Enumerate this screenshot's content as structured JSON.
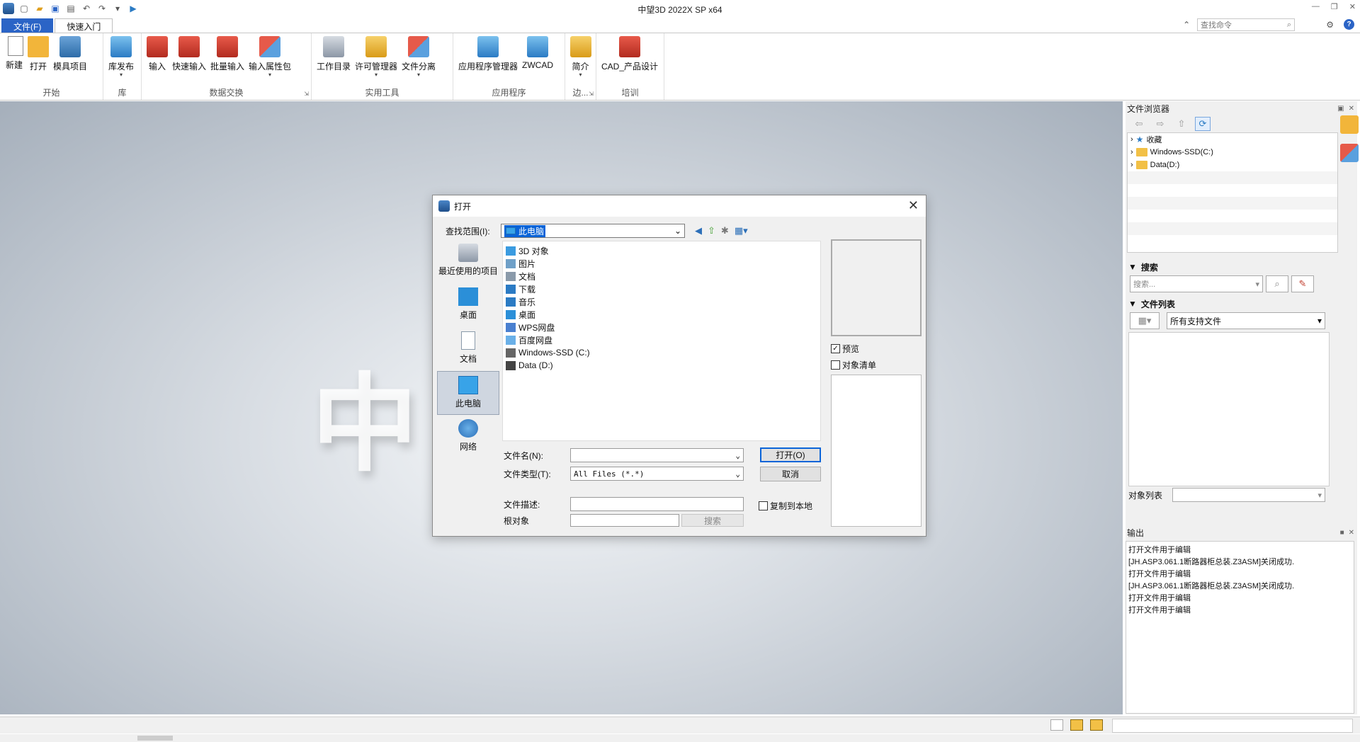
{
  "window": {
    "title": "中望3D 2022X SP x64",
    "search_cmd_placeholder": "查找命令"
  },
  "ribbon_tabs": [
    {
      "label": "文件(F)"
    },
    {
      "label": "快速入门"
    }
  ],
  "ribbon_groups": [
    {
      "label": "开始",
      "buttons": [
        {
          "label": "新建",
          "icon": "new-doc-icon"
        },
        {
          "label": "打开",
          "icon": "open-folder-icon"
        },
        {
          "label": "模具项目",
          "icon": "mold-project-icon"
        }
      ]
    },
    {
      "label": "库",
      "buttons": [
        {
          "label": "库发布",
          "icon": "library-publish-icon"
        }
      ]
    },
    {
      "label": "数据交换",
      "buttons": [
        {
          "label": "输入",
          "icon": "import-icon"
        },
        {
          "label": "快速输入",
          "icon": "quick-import-icon"
        },
        {
          "label": "批量输入",
          "icon": "batch-import-icon"
        },
        {
          "label": "输入属性包",
          "icon": "import-attr-pack-icon"
        }
      ]
    },
    {
      "label": "实用工具",
      "buttons": [
        {
          "label": "工作目录",
          "icon": "work-dir-icon"
        },
        {
          "label": "许可管理器",
          "icon": "license-manager-icon"
        },
        {
          "label": "文件分离",
          "icon": "file-split-icon"
        }
      ]
    },
    {
      "label": "应用程序",
      "buttons": [
        {
          "label": "应用程序管理器",
          "icon": "app-manager-icon"
        },
        {
          "label": "ZWCAD",
          "icon": "zwcad-icon"
        }
      ]
    },
    {
      "label": "边...",
      "buttons": [
        {
          "label": "简介",
          "icon": "intro-icon"
        }
      ]
    },
    {
      "label": "培训",
      "buttons": [
        {
          "label": "CAD_产品设计",
          "icon": "cad-product-design-icon"
        }
      ]
    }
  ],
  "dialog": {
    "title": "打开",
    "look_in_label": "查找范围(I):",
    "look_in_value": "此电脑",
    "places": [
      {
        "label": "最近使用的项目",
        "icon": "recent-items-icon"
      },
      {
        "label": "桌面",
        "icon": "desktop-icon"
      },
      {
        "label": "文档",
        "icon": "documents-icon"
      },
      {
        "label": "此电脑",
        "icon": "this-pc-icon"
      },
      {
        "label": "网络",
        "icon": "network-icon"
      }
    ],
    "files": [
      {
        "name": "3D 对象",
        "icon": "3d-objects-icon",
        "color": "#3a9be0"
      },
      {
        "name": "图片",
        "icon": "pictures-icon",
        "color": "#6fa0c8"
      },
      {
        "name": "文档",
        "icon": "documents-icon",
        "color": "#8a9aaa"
      },
      {
        "name": "下载",
        "icon": "downloads-icon",
        "color": "#2b7bc4"
      },
      {
        "name": "音乐",
        "icon": "music-icon",
        "color": "#2b7bc4"
      },
      {
        "name": "桌面",
        "icon": "desktop-icon",
        "color": "#2b8fd8"
      },
      {
        "name": "WPS网盘",
        "icon": "wps-cloud-icon",
        "color": "#4a80d0"
      },
      {
        "name": "百度网盘",
        "icon": "baidu-cloud-icon",
        "color": "#6ab0e8"
      },
      {
        "name": "Windows-SSD (C:)",
        "icon": "drive-c-icon",
        "color": "#666666"
      },
      {
        "name": "Data (D:)",
        "icon": "drive-d-icon",
        "color": "#444444"
      }
    ],
    "preview_label": "预览",
    "object_list_label": "对象清单",
    "filename_label": "文件名(N):",
    "filename_value": "",
    "filetype_label": "文件类型(T):",
    "filetype_value": "All Files (*.*)",
    "open_button": "打开(O)",
    "cancel_button": "取消",
    "desc_label": "文件描述:",
    "root_label": "根对象",
    "copy_local_label": "复制到本地",
    "search_button": "搜索"
  },
  "file_browser": {
    "title": "文件浏览器",
    "tree": [
      {
        "label": "收藏",
        "icon": "star-icon"
      },
      {
        "label": "Windows-SSD(C:)",
        "icon": "folder-icon"
      },
      {
        "label": "Data(D:)",
        "icon": "folder-icon"
      }
    ],
    "search_head": "搜索",
    "search_placeholder": "搜索...",
    "filelist_head": "文件列表",
    "filter_value": "所有支持文件",
    "object_list_label": "对象列表"
  },
  "output": {
    "title": "输出",
    "lines": [
      "打开文件用于编辑",
      "[JH.ASP3.061.1断路器柜总装.Z3ASM]关闭成功.",
      "打开文件用于编辑",
      "[JH.ASP3.061.1断路器柜总装.Z3ASM]关闭成功.",
      "打开文件用于编辑",
      "打开文件用于编辑"
    ]
  },
  "background_logo": "中"
}
